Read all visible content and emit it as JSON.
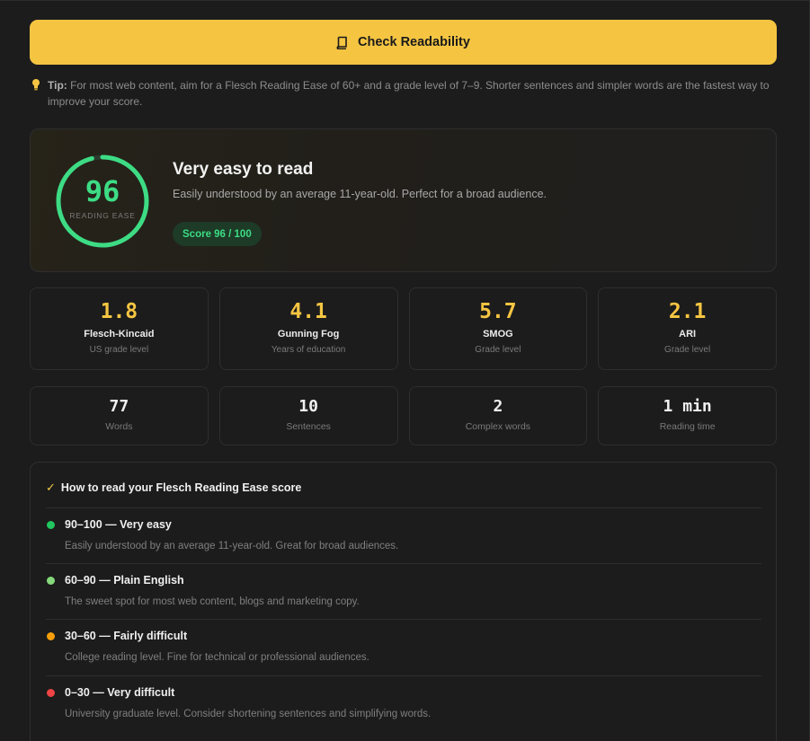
{
  "check_button": {
    "label": "Check Readability",
    "icon": "book-icon",
    "color": "#f5c542"
  },
  "tip": {
    "label": "Tip:",
    "text": "For most web content, aim for a Flesch Reading Ease of 60+ and a grade level of 7–9. Shorter sentences and simpler words are the fastest way to improve your score.",
    "icon": "lightbulb-icon"
  },
  "score": {
    "value": "96",
    "ring_fraction": 0.96,
    "ring_label": "READING EASE",
    "title": "Very easy to read",
    "description": "Easily understood by an average 11-year-old. Perfect for a broad audience.",
    "pill": "Score 96 / 100",
    "color": "#3ddc84"
  },
  "grade_metrics": [
    {
      "value": "1.8",
      "name": "Flesch-Kincaid",
      "sub": "US grade level"
    },
    {
      "value": "4.1",
      "name": "Gunning Fog",
      "sub": "Years of education"
    },
    {
      "value": "5.7",
      "name": "SMOG",
      "sub": "Grade level"
    },
    {
      "value": "2.1",
      "name": "ARI",
      "sub": "Grade level"
    }
  ],
  "count_metrics": [
    {
      "value": "77",
      "sub": "Words"
    },
    {
      "value": "10",
      "sub": "Sentences"
    },
    {
      "value": "2",
      "sub": "Complex words"
    },
    {
      "value": "1 min",
      "sub": "Reading time"
    }
  ],
  "guide": {
    "check": "✓",
    "title": "How to read your Flesch Reading Ease score",
    "items": [
      {
        "title": "90–100 — Very easy",
        "desc": "Easily understood by an average 11-year-old. Great for broad audiences.",
        "color": "#22c55e"
      },
      {
        "title": "60–90 — Plain English",
        "desc": "The sweet spot for most web content, blogs and marketing copy.",
        "color": "#86d97a"
      },
      {
        "title": "30–60 — Fairly difficult",
        "desc": "College reading level. Fine for technical or professional audiences.",
        "color": "#f59e0b"
      },
      {
        "title": "0–30 — Very difficult",
        "desc": "University graduate level. Consider shortening sentences and simplifying words.",
        "color": "#ef4444"
      }
    ]
  }
}
